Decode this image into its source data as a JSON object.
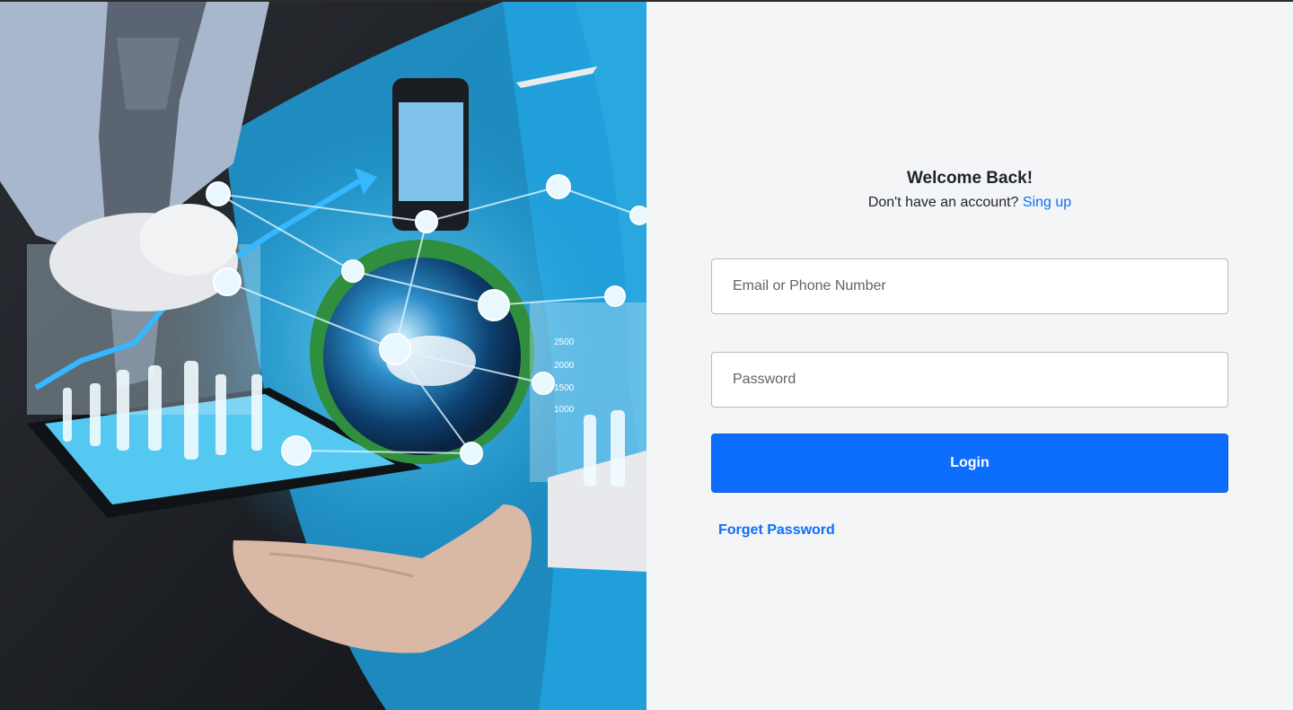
{
  "hero": {
    "chart_ticks": [
      "2500",
      "2000",
      "1500",
      "1000"
    ]
  },
  "login": {
    "title": "Welcome Back!",
    "signup_prompt": "Don't have an account?",
    "signup_link": "Sing up",
    "email_placeholder": "Email or Phone Number",
    "password_placeholder": "Password",
    "login_button": "Login",
    "forget_link": "Forget Password"
  },
  "colors": {
    "accent": "#0d6efd",
    "panel_bg": "#f4f5f7",
    "text": "#1f2328"
  }
}
